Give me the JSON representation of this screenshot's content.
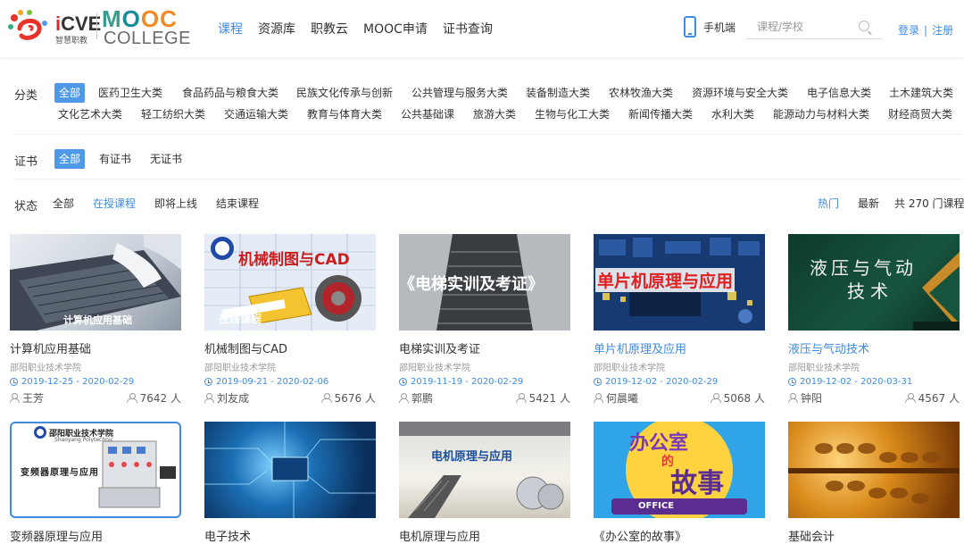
{
  "header": {
    "icve": {
      "brand": "iCVE",
      "subtitle": "智慧职教"
    },
    "mooc": {
      "word": "MOOC",
      "college": "COLLEGE"
    },
    "nav": [
      "课程",
      "资源库",
      "职教云",
      "MOOC申请",
      "证书查询"
    ],
    "phone_label": "手机端",
    "search_placeholder": "课程/学校",
    "login": "登录",
    "auth_sep": "|",
    "register": "注册",
    "colors": {
      "accent": "#3f8be0",
      "chip": "#4f9ae8"
    }
  },
  "filters": {
    "category": {
      "label": "分类",
      "row1": [
        "全部",
        "医药卫生大类",
        "食品药品与粮食大类",
        "民族文化传承与创新",
        "公共管理与服务大类",
        "装备制造大类",
        "农林牧渔大类",
        "资源环境与安全大类",
        "电子信息大类",
        "土木建筑大类"
      ],
      "row2": [
        "文化艺术大类",
        "轻工纺织大类",
        "交通运输大类",
        "教育与体育大类",
        "公共基础课",
        "旅游大类",
        "生物与化工大类",
        "新闻传播大类",
        "水利大类",
        "能源动力与材料大类",
        "财经商贸大类"
      ]
    },
    "certificate": {
      "label": "证书",
      "options": [
        "全部",
        "有证书",
        "无证书"
      ]
    },
    "status": {
      "label": "状态",
      "options": [
        "全部",
        "在授课程",
        "即将上线",
        "结束课程"
      ]
    },
    "sort": {
      "hot": "热门",
      "newest": "最新",
      "total": "共 270 门课程"
    }
  },
  "courses": [
    {
      "title": "计算机应用基础",
      "school": "邵阳职业技术学院",
      "date": "2019-12-25 - 2020-02-29",
      "teacher": "王芳",
      "count": "7642 人",
      "thumb_text": "计算机应用基础"
    },
    {
      "title": "机械制图与CAD",
      "school": "邵阳职业技术学院",
      "date": "2019-09-21 - 2020-02-06",
      "teacher": "刘友成",
      "count": "5676 人",
      "thumb_text": "机械制图与CAD",
      "thumb_sub": "在线课程"
    },
    {
      "title": "电梯实训及考证",
      "school": "邵阳职业技术学院",
      "date": "2019-11-19 - 2020-02-29",
      "teacher": "郭鹏",
      "count": "5421 人",
      "thumb_text": "《电梯实训及考证》"
    },
    {
      "title": "单片机原理及应用",
      "school": "邵阳职业技术学院",
      "date": "2019-12-02 - 2020-02-29",
      "teacher": "何晨曦",
      "count": "5068 人",
      "thumb_text": "单片机原理与应用"
    },
    {
      "title": "液压与气动技术",
      "school": "邵阳职业技术学院",
      "date": "2019-12-02 - 2020-03-31",
      "teacher": "钟阳",
      "count": "4567 人",
      "thumb_text": "液压与气动",
      "thumb_text2": "技术"
    },
    {
      "title": "变频器原理与应用",
      "thumb_text": "变频器原理与应用",
      "thumb_header": "邵阳职业技术学院",
      "thumb_header_en": "Shaoyang Polytechnic"
    },
    {
      "title": "电子技术"
    },
    {
      "title": "电机原理与应用",
      "thumb_text": "电机原理与应用"
    },
    {
      "title": "《办公室的故事》",
      "thumb_text": "办公室",
      "thumb_text2": "的",
      "thumb_text3": "故事",
      "thumb_sub": "OFFICE"
    },
    {
      "title": "基础会计"
    }
  ]
}
